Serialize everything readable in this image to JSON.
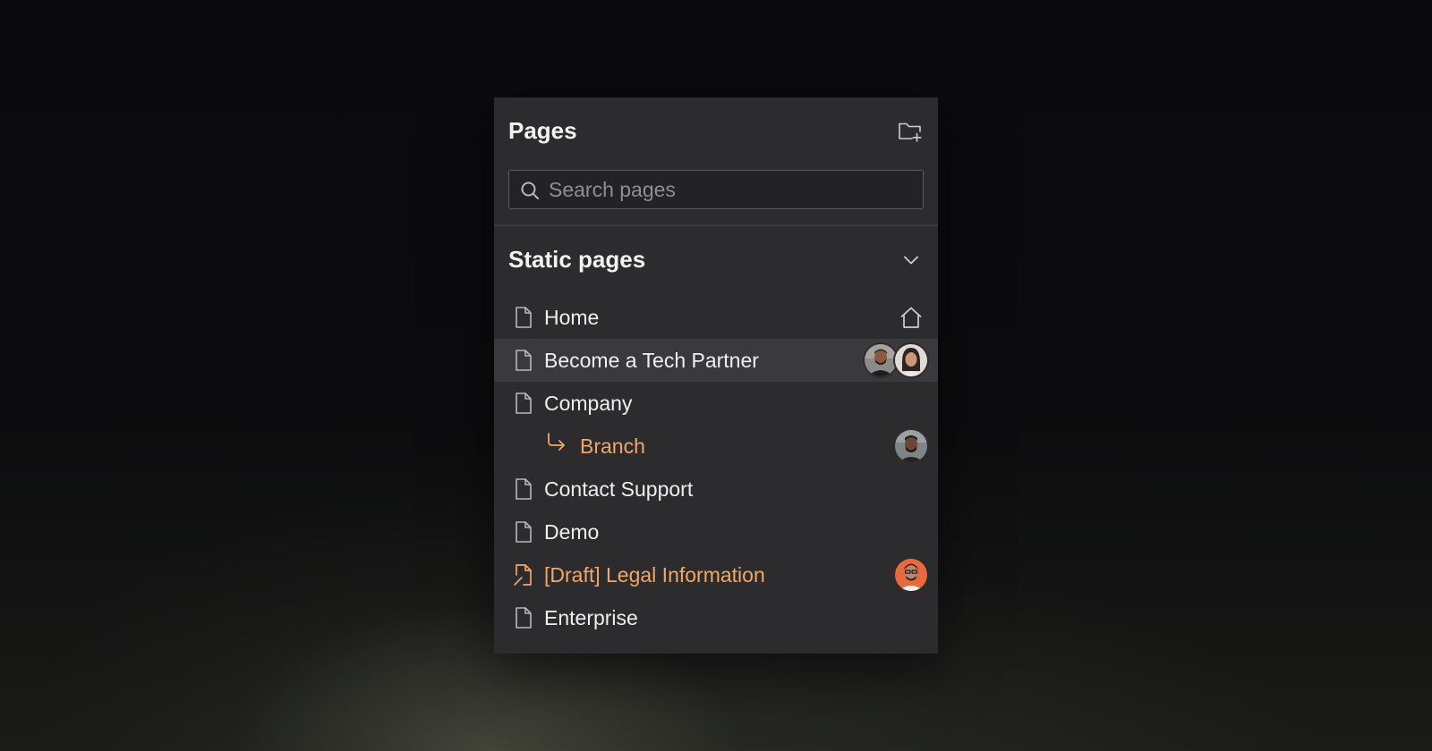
{
  "panel": {
    "title": "Pages",
    "new_folder_icon": "folder-plus-icon"
  },
  "search": {
    "placeholder": "Search pages",
    "value": "",
    "icon": "search-icon"
  },
  "section": {
    "title": "Static pages",
    "expanded": true,
    "toggle_icon": "chevron-down-icon"
  },
  "pages": [
    {
      "label": "Home",
      "icon": "file-icon",
      "trailing": "home-icon"
    },
    {
      "label": "Become a Tech Partner",
      "icon": "file-icon",
      "selected": true,
      "collaborators": 2
    },
    {
      "label": "Company",
      "icon": "file-icon"
    },
    {
      "label": "Branch",
      "icon": "branch-arrow-icon",
      "child": true,
      "collaborators": 1
    },
    {
      "label": "Contact Support",
      "icon": "file-icon"
    },
    {
      "label": "Demo",
      "icon": "file-icon"
    },
    {
      "label": "[Draft] Legal Information",
      "icon": "draft-file-icon",
      "draft": true,
      "collaborators": 1
    },
    {
      "label": "Enterprise",
      "icon": "file-icon"
    }
  ],
  "colors": {
    "panel_bg": "#2c2b2d",
    "selected_row_bg": "#3a393d",
    "accent": "#f3a767",
    "text": "#efefef"
  }
}
